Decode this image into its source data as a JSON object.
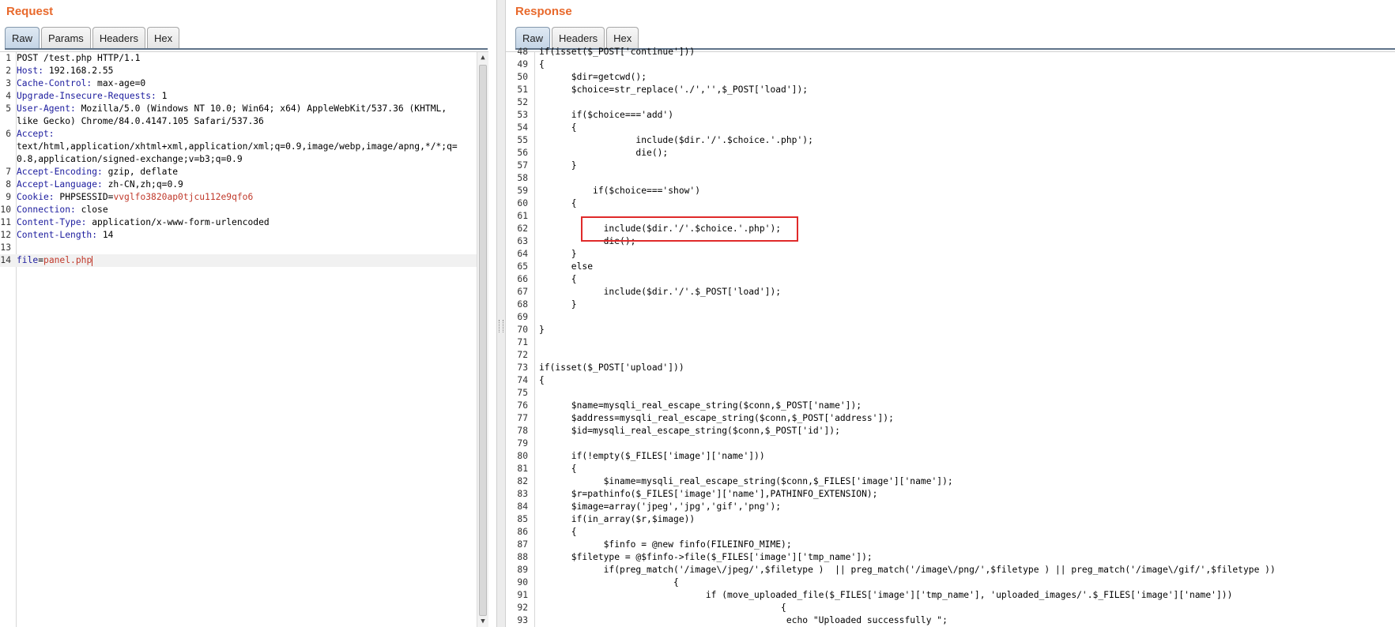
{
  "request": {
    "title": "Request",
    "tabs": [
      "Raw",
      "Params",
      "Headers",
      "Hex"
    ],
    "active_tab": "Raw",
    "lines": [
      {
        "n": "1",
        "k": "POST /test.php HTTP/1.1",
        "v": "",
        "type": "plain"
      },
      {
        "n": "2",
        "k": "Host:",
        "v": " 192.168.2.55",
        "type": "header"
      },
      {
        "n": "3",
        "k": "Cache-Control:",
        "v": " max-age=0",
        "type": "header"
      },
      {
        "n": "4",
        "k": "Upgrade-Insecure-Requests:",
        "v": " 1",
        "type": "header"
      },
      {
        "n": "5",
        "k": "User-Agent:",
        "v": " Mozilla/5.0 (Windows NT 10.0; Win64; x64) AppleWebKit/537.36 (KHTML,",
        "type": "header"
      },
      {
        "n": "",
        "k": "like Gecko) Chrome/84.0.4147.105 Safari/537.36",
        "v": "",
        "type": "plain"
      },
      {
        "n": "6",
        "k": "Accept:",
        "v": "",
        "type": "header"
      },
      {
        "n": "",
        "k": "text/html,application/xhtml+xml,application/xml;q=0.9,image/webp,image/apng,*/*;q=",
        "v": "",
        "type": "plain"
      },
      {
        "n": "",
        "k": "0.8,application/signed-exchange;v=b3;q=0.9",
        "v": "",
        "type": "plain"
      },
      {
        "n": "7",
        "k": "Accept-Encoding:",
        "v": " gzip, deflate",
        "type": "header"
      },
      {
        "n": "8",
        "k": "Accept-Language:",
        "v": " zh-CN,zh;q=0.9",
        "type": "header"
      },
      {
        "n": "9",
        "k": "Cookie:",
        "v": " PHPSESSID=",
        "v2": "vvglfo3820ap0tjcu112e9qfo6",
        "type": "cookie"
      },
      {
        "n": "10",
        "k": "Connection:",
        "v": " close",
        "type": "header"
      },
      {
        "n": "11",
        "k": "Content-Type:",
        "v": " application/x-www-form-urlencoded",
        "type": "header"
      },
      {
        "n": "12",
        "k": "Content-Length:",
        "v": " 14",
        "type": "header"
      },
      {
        "n": "13",
        "k": "",
        "v": "",
        "type": "plain"
      },
      {
        "n": "14",
        "k": "file",
        "v": "=",
        "v2": "panel.php",
        "type": "param"
      }
    ]
  },
  "response": {
    "title": "Response",
    "tabs": [
      "Raw",
      "Headers",
      "Hex"
    ],
    "active_tab": "Raw",
    "lines": [
      {
        "n": "48",
        "t": "if(isset($_POST['continue']))"
      },
      {
        "n": "49",
        "t": "{"
      },
      {
        "n": "50",
        "t": "      $dir=getcwd();"
      },
      {
        "n": "51",
        "t": "      $choice=str_replace('./','',$_POST['load']);"
      },
      {
        "n": "52",
        "t": ""
      },
      {
        "n": "53",
        "t": "      if($choice==='add')"
      },
      {
        "n": "54",
        "t": "      {"
      },
      {
        "n": "55",
        "t": "                  include($dir.'/'.$choice.'.php');"
      },
      {
        "n": "56",
        "t": "                  die();"
      },
      {
        "n": "57",
        "t": "      }"
      },
      {
        "n": "58",
        "t": ""
      },
      {
        "n": "59",
        "t": "          if($choice==='show')"
      },
      {
        "n": "60",
        "t": "      {"
      },
      {
        "n": "61",
        "t": ""
      },
      {
        "n": "62",
        "t": "            include($dir.'/'.$choice.'.php');"
      },
      {
        "n": "63",
        "t": "            die();"
      },
      {
        "n": "64",
        "t": "      }"
      },
      {
        "n": "65",
        "t": "      else"
      },
      {
        "n": "66",
        "t": "      {"
      },
      {
        "n": "67",
        "t": "            include($dir.'/'.$_POST['load']);"
      },
      {
        "n": "68",
        "t": "      }"
      },
      {
        "n": "69",
        "t": ""
      },
      {
        "n": "70",
        "t": "}"
      },
      {
        "n": "71",
        "t": ""
      },
      {
        "n": "72",
        "t": ""
      },
      {
        "n": "73",
        "t": "if(isset($_POST['upload']))"
      },
      {
        "n": "74",
        "t": "{"
      },
      {
        "n": "75",
        "t": ""
      },
      {
        "n": "76",
        "t": "      $name=mysqli_real_escape_string($conn,$_POST['name']);"
      },
      {
        "n": "77",
        "t": "      $address=mysqli_real_escape_string($conn,$_POST['address']);"
      },
      {
        "n": "78",
        "t": "      $id=mysqli_real_escape_string($conn,$_POST['id']);"
      },
      {
        "n": "79",
        "t": ""
      },
      {
        "n": "80",
        "t": "      if(!empty($_FILES['image']['name']))"
      },
      {
        "n": "81",
        "t": "      {"
      },
      {
        "n": "82",
        "t": "            $iname=mysqli_real_escape_string($conn,$_FILES['image']['name']);"
      },
      {
        "n": "83",
        "t": "      $r=pathinfo($_FILES['image']['name'],PATHINFO_EXTENSION);"
      },
      {
        "n": "84",
        "t": "      $image=array('jpeg','jpg','gif','png');"
      },
      {
        "n": "85",
        "t": "      if(in_array($r,$image))"
      },
      {
        "n": "86",
        "t": "      {"
      },
      {
        "n": "87",
        "t": "            $finfo = @new finfo(FILEINFO_MIME);"
      },
      {
        "n": "88",
        "t": "      $filetype = @$finfo->file($_FILES['image']['tmp_name']);"
      },
      {
        "n": "89",
        "t": "            if(preg_match('/image\\/jpeg/',$filetype )  || preg_match('/image\\/png/',$filetype ) || preg_match('/image\\/gif/',$filetype ))"
      },
      {
        "n": "90",
        "t": "                         {"
      },
      {
        "n": "91",
        "t": "                               if (move_uploaded_file($_FILES['image']['tmp_name'], 'uploaded_images/'.$_FILES['image']['name']))"
      },
      {
        "n": "92",
        "t": "                                             {"
      },
      {
        "n": "93",
        "t": "                                              echo \"Uploaded successfully \";"
      }
    ]
  }
}
